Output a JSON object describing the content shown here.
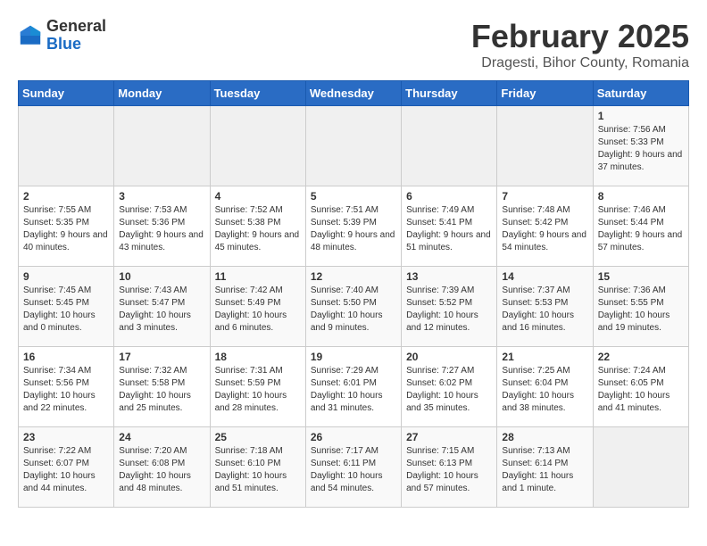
{
  "logo": {
    "general": "General",
    "blue": "Blue"
  },
  "header": {
    "month": "February 2025",
    "location": "Dragesti, Bihor County, Romania"
  },
  "weekdays": [
    "Sunday",
    "Monday",
    "Tuesday",
    "Wednesday",
    "Thursday",
    "Friday",
    "Saturday"
  ],
  "weeks": [
    [
      {
        "day": "",
        "info": ""
      },
      {
        "day": "",
        "info": ""
      },
      {
        "day": "",
        "info": ""
      },
      {
        "day": "",
        "info": ""
      },
      {
        "day": "",
        "info": ""
      },
      {
        "day": "",
        "info": ""
      },
      {
        "day": "1",
        "info": "Sunrise: 7:56 AM\nSunset: 5:33 PM\nDaylight: 9 hours and 37 minutes."
      }
    ],
    [
      {
        "day": "2",
        "info": "Sunrise: 7:55 AM\nSunset: 5:35 PM\nDaylight: 9 hours and 40 minutes."
      },
      {
        "day": "3",
        "info": "Sunrise: 7:53 AM\nSunset: 5:36 PM\nDaylight: 9 hours and 43 minutes."
      },
      {
        "day": "4",
        "info": "Sunrise: 7:52 AM\nSunset: 5:38 PM\nDaylight: 9 hours and 45 minutes."
      },
      {
        "day": "5",
        "info": "Sunrise: 7:51 AM\nSunset: 5:39 PM\nDaylight: 9 hours and 48 minutes."
      },
      {
        "day": "6",
        "info": "Sunrise: 7:49 AM\nSunset: 5:41 PM\nDaylight: 9 hours and 51 minutes."
      },
      {
        "day": "7",
        "info": "Sunrise: 7:48 AM\nSunset: 5:42 PM\nDaylight: 9 hours and 54 minutes."
      },
      {
        "day": "8",
        "info": "Sunrise: 7:46 AM\nSunset: 5:44 PM\nDaylight: 9 hours and 57 minutes."
      }
    ],
    [
      {
        "day": "9",
        "info": "Sunrise: 7:45 AM\nSunset: 5:45 PM\nDaylight: 10 hours and 0 minutes."
      },
      {
        "day": "10",
        "info": "Sunrise: 7:43 AM\nSunset: 5:47 PM\nDaylight: 10 hours and 3 minutes."
      },
      {
        "day": "11",
        "info": "Sunrise: 7:42 AM\nSunset: 5:49 PM\nDaylight: 10 hours and 6 minutes."
      },
      {
        "day": "12",
        "info": "Sunrise: 7:40 AM\nSunset: 5:50 PM\nDaylight: 10 hours and 9 minutes."
      },
      {
        "day": "13",
        "info": "Sunrise: 7:39 AM\nSunset: 5:52 PM\nDaylight: 10 hours and 12 minutes."
      },
      {
        "day": "14",
        "info": "Sunrise: 7:37 AM\nSunset: 5:53 PM\nDaylight: 10 hours and 16 minutes."
      },
      {
        "day": "15",
        "info": "Sunrise: 7:36 AM\nSunset: 5:55 PM\nDaylight: 10 hours and 19 minutes."
      }
    ],
    [
      {
        "day": "16",
        "info": "Sunrise: 7:34 AM\nSunset: 5:56 PM\nDaylight: 10 hours and 22 minutes."
      },
      {
        "day": "17",
        "info": "Sunrise: 7:32 AM\nSunset: 5:58 PM\nDaylight: 10 hours and 25 minutes."
      },
      {
        "day": "18",
        "info": "Sunrise: 7:31 AM\nSunset: 5:59 PM\nDaylight: 10 hours and 28 minutes."
      },
      {
        "day": "19",
        "info": "Sunrise: 7:29 AM\nSunset: 6:01 PM\nDaylight: 10 hours and 31 minutes."
      },
      {
        "day": "20",
        "info": "Sunrise: 7:27 AM\nSunset: 6:02 PM\nDaylight: 10 hours and 35 minutes."
      },
      {
        "day": "21",
        "info": "Sunrise: 7:25 AM\nSunset: 6:04 PM\nDaylight: 10 hours and 38 minutes."
      },
      {
        "day": "22",
        "info": "Sunrise: 7:24 AM\nSunset: 6:05 PM\nDaylight: 10 hours and 41 minutes."
      }
    ],
    [
      {
        "day": "23",
        "info": "Sunrise: 7:22 AM\nSunset: 6:07 PM\nDaylight: 10 hours and 44 minutes."
      },
      {
        "day": "24",
        "info": "Sunrise: 7:20 AM\nSunset: 6:08 PM\nDaylight: 10 hours and 48 minutes."
      },
      {
        "day": "25",
        "info": "Sunrise: 7:18 AM\nSunset: 6:10 PM\nDaylight: 10 hours and 51 minutes."
      },
      {
        "day": "26",
        "info": "Sunrise: 7:17 AM\nSunset: 6:11 PM\nDaylight: 10 hours and 54 minutes."
      },
      {
        "day": "27",
        "info": "Sunrise: 7:15 AM\nSunset: 6:13 PM\nDaylight: 10 hours and 57 minutes."
      },
      {
        "day": "28",
        "info": "Sunrise: 7:13 AM\nSunset: 6:14 PM\nDaylight: 11 hours and 1 minute."
      },
      {
        "day": "",
        "info": ""
      }
    ]
  ]
}
